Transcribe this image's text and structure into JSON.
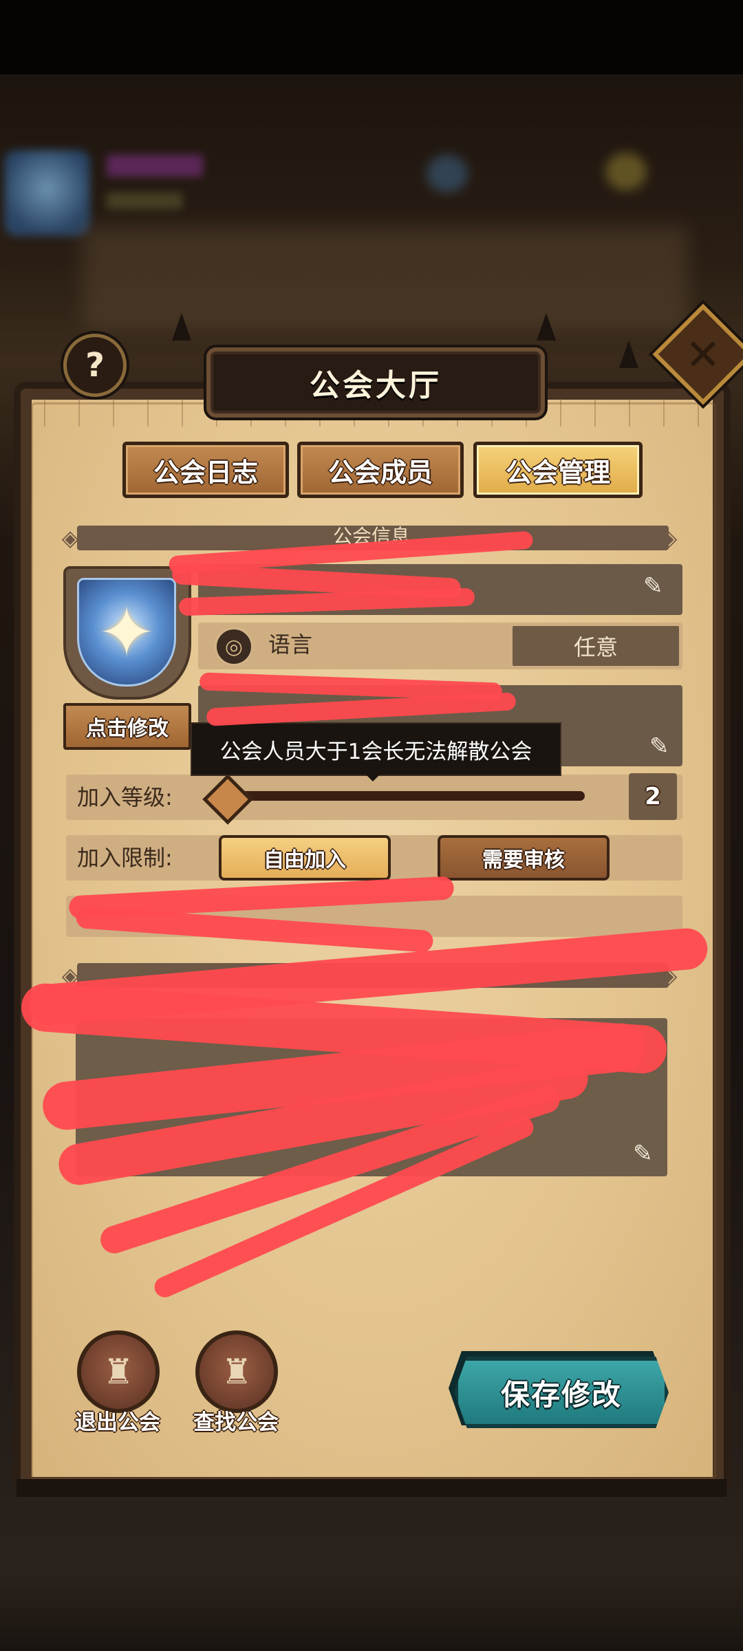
{
  "dialog": {
    "title": "公会大厅",
    "help_symbol": "?",
    "close_symbol": "✕"
  },
  "tabs": [
    {
      "label": "公会日志",
      "active": false
    },
    {
      "label": "公会成员",
      "active": false
    },
    {
      "label": "公会管理",
      "active": true
    }
  ],
  "info_section": {
    "title": "公会信息"
  },
  "emblem": {
    "edit_button": "点击修改",
    "icon": "compass-star-icon"
  },
  "language": {
    "label": "语言",
    "value": "任意"
  },
  "tooltip": {
    "text": "公会人员大于1会长无法解散公会"
  },
  "join_level": {
    "label": "加入等级:",
    "value": "2"
  },
  "join_restriction": {
    "label": "加入限制:",
    "options": [
      {
        "label": "自由加入",
        "selected": true
      },
      {
        "label": "需要审核",
        "selected": false
      }
    ]
  },
  "bottom_actions": {
    "leave_label": "退出公会",
    "find_label": "查找公会",
    "save_label": "保存修改"
  },
  "colors": {
    "panel": "#e3c48f",
    "accent_teal": "#2a8d90",
    "redaction": "#ff4a4f"
  }
}
